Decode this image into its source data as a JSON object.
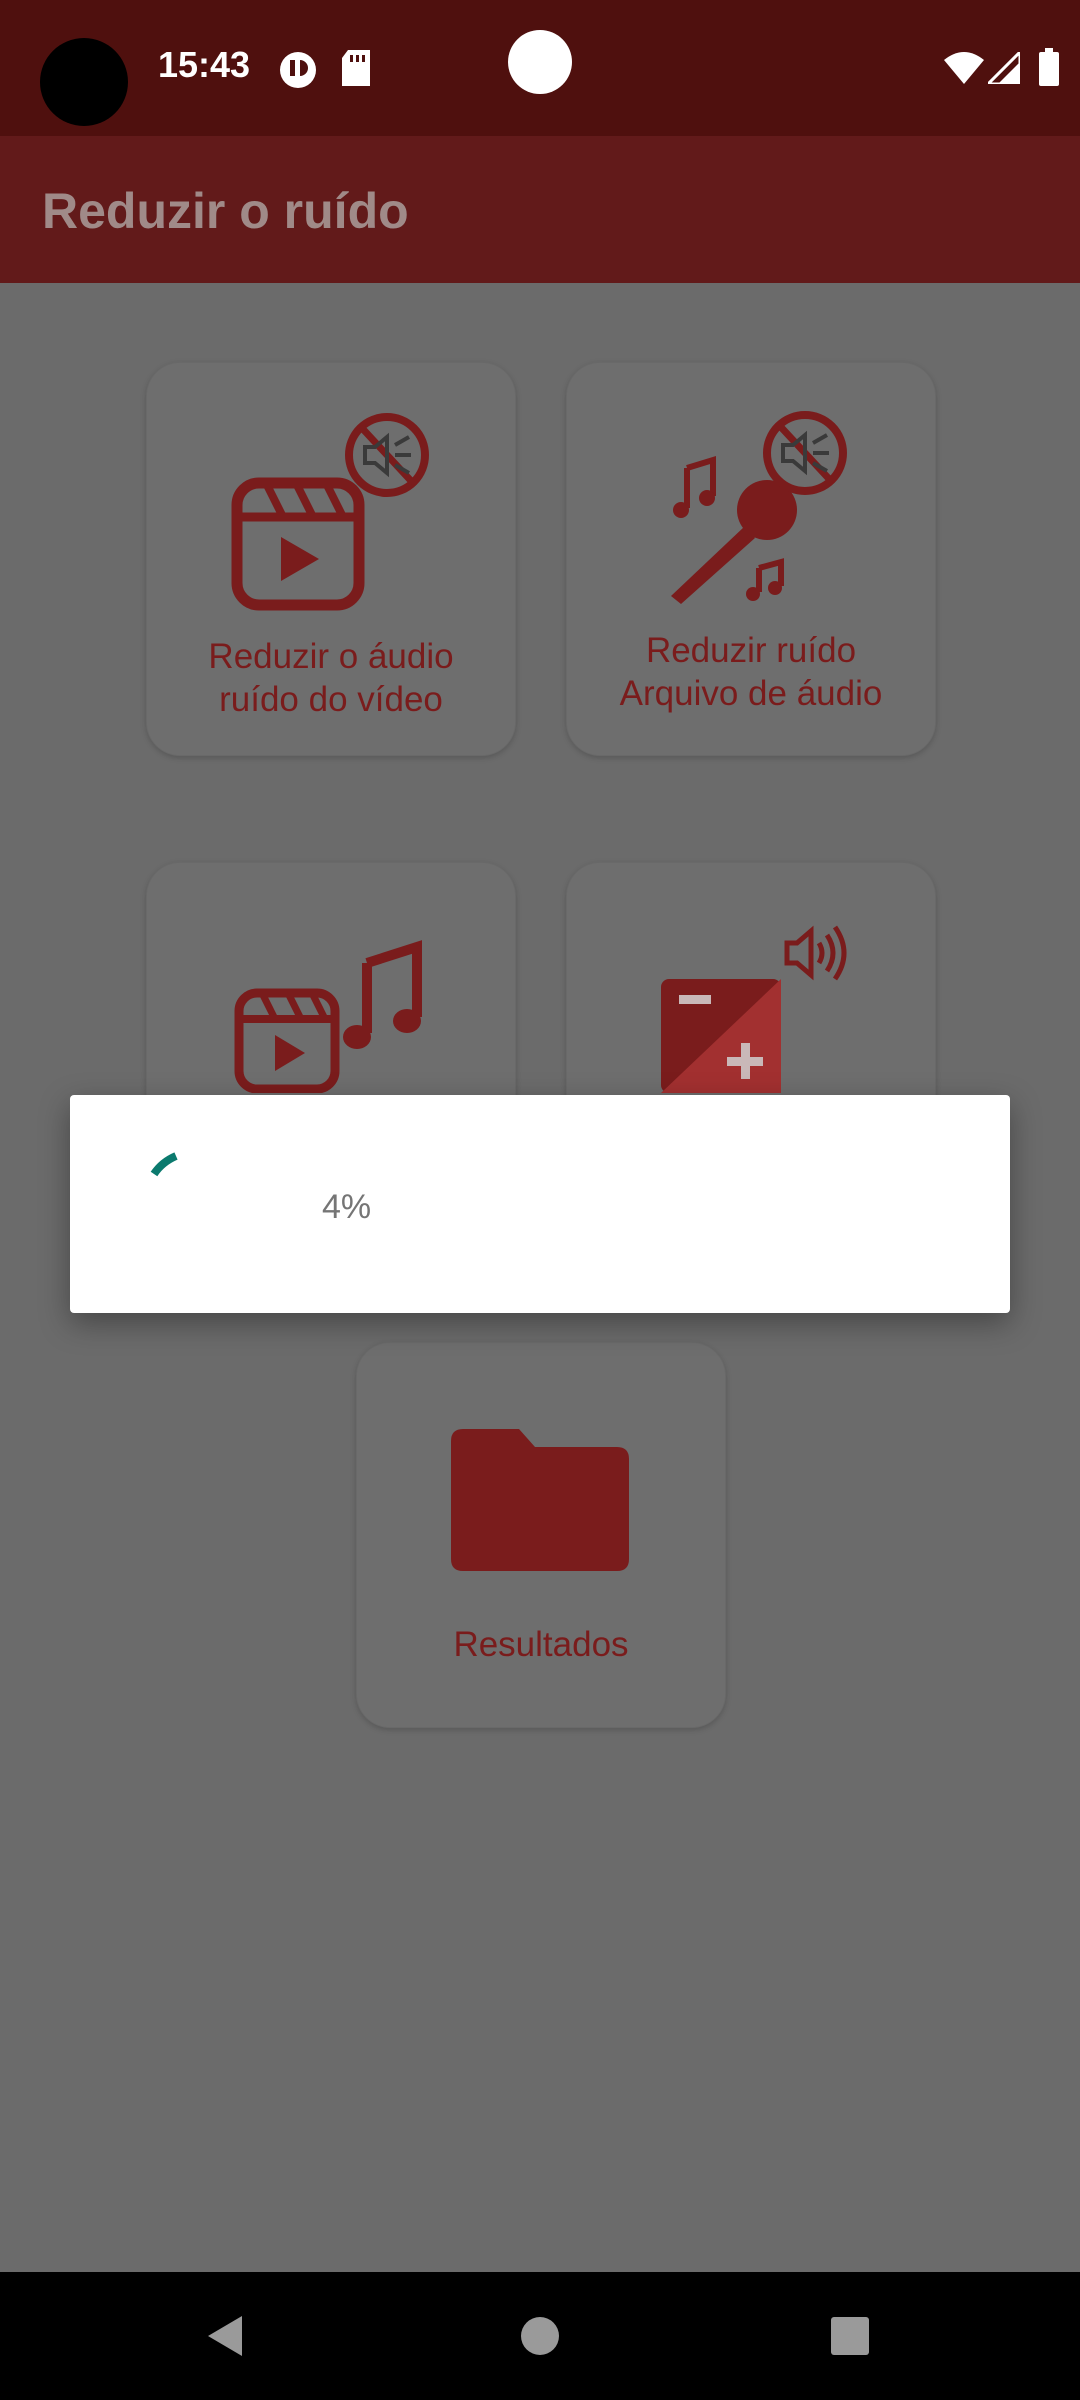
{
  "status_bar": {
    "time": "15:43",
    "icons": [
      "camera-cutout",
      "data-saver-icon",
      "sd-card-icon",
      "wifi-icon",
      "signal-icon",
      "battery-icon"
    ]
  },
  "app_bar": {
    "title": "Reduzir o ruído"
  },
  "cards": [
    {
      "label_line1": "Reduzir o áudio",
      "label_line2": "ruído do vídeo",
      "icon": "video-noise-reduce-icon"
    },
    {
      "label_line1": "Reduzir ruído",
      "label_line2": "Arquivo de áudio",
      "icon": "microphone-noise-reduce-icon"
    },
    {
      "label_line1": "",
      "label_line2": "",
      "icon": "video-to-music-icon"
    },
    {
      "label_line1": "",
      "label_line2": "",
      "icon": "volume-adjust-icon"
    },
    {
      "label_line1": "Resultados",
      "label_line2": "",
      "icon": "folder-icon"
    }
  ],
  "progress_dialog": {
    "percent_text": "4%",
    "progress": 0.04
  },
  "nav_bar": {
    "buttons": [
      "back-button",
      "home-button",
      "recents-button"
    ]
  },
  "colors": {
    "status_bar": "#4f100e",
    "app_bar": "#621a1a",
    "scrim_background": "#6b6b6b",
    "card_text": "#7a1c1c",
    "icon_red": "#7a1c1c",
    "spinner_teal": "#0b7a6e"
  }
}
